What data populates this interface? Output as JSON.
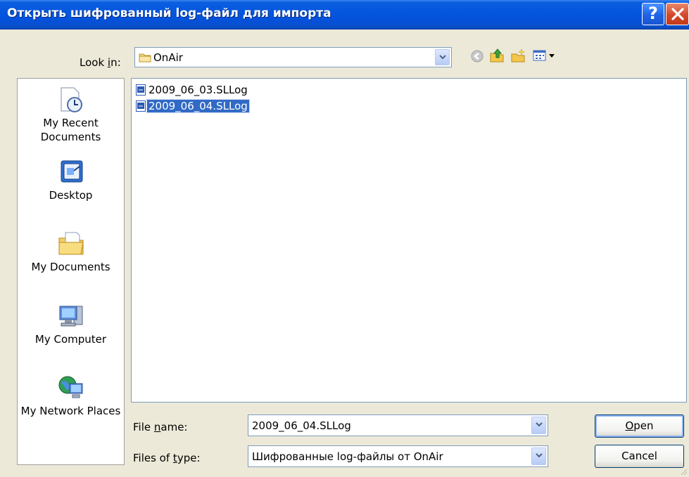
{
  "window": {
    "title": "Открыть шифрованный log-файл для импорта",
    "help_label": "?",
    "close_label": "✕"
  },
  "lookin": {
    "label": "Look in:",
    "value": "OnAir"
  },
  "toolbar": {
    "icons": [
      "back-icon",
      "up-folder-icon",
      "new-folder-icon",
      "view-menu-icon"
    ]
  },
  "places": [
    {
      "label": "My Recent Documents",
      "icon": "recent-documents-icon"
    },
    {
      "label": "Desktop",
      "icon": "desktop-icon"
    },
    {
      "label": "My Documents",
      "icon": "my-documents-icon"
    },
    {
      "label": "My Computer",
      "icon": "my-computer-icon"
    },
    {
      "label": "My Network Places",
      "icon": "network-places-icon"
    }
  ],
  "files": [
    {
      "name": "2009_06_03.SLLog",
      "selected": false
    },
    {
      "name": "2009_06_04.SLLog",
      "selected": true
    }
  ],
  "filename": {
    "label": "File name:",
    "value": "2009_06_04.SLLog"
  },
  "filetype": {
    "label": "Files of type:",
    "value": "Шифрованные log-файлы от OnAir"
  },
  "buttons": {
    "open": "Open",
    "cancel": "Cancel"
  },
  "colors": {
    "title_bar": "#0556de",
    "selection": "#316ac5",
    "dialog_bg": "#ece9d8"
  }
}
